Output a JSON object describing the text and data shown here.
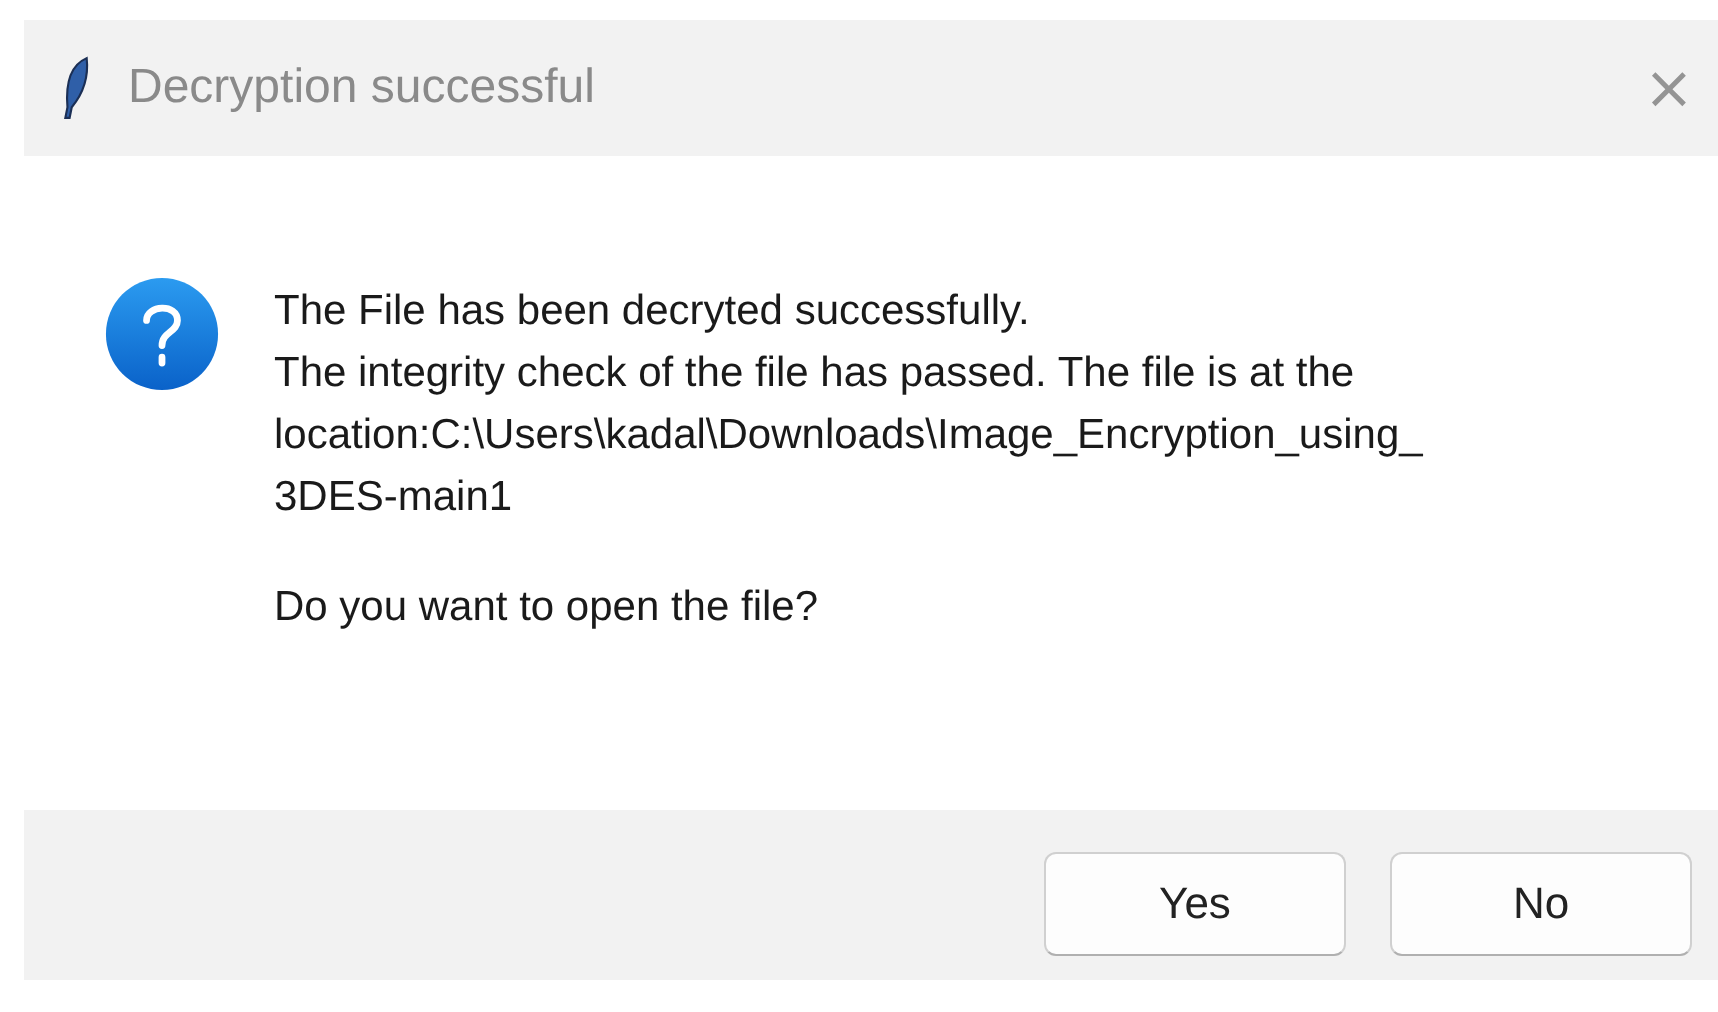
{
  "window": {
    "title": "Decryption successful",
    "close_button": {
      "label": "×",
      "disabled": true
    }
  },
  "message": {
    "kind": "question",
    "paragraphs": [
      [
        "The File has been decryted successfully.",
        "The integrity check of the file has passed. The file is at the",
        "location:C:\\Users\\kadal\\Downloads\\Image_Encryption_using_",
        "3DES-main1"
      ],
      [
        "Do you want to open the file?"
      ]
    ]
  },
  "buttons": [
    {
      "label": "Yes"
    },
    {
      "label": "No"
    }
  ]
}
